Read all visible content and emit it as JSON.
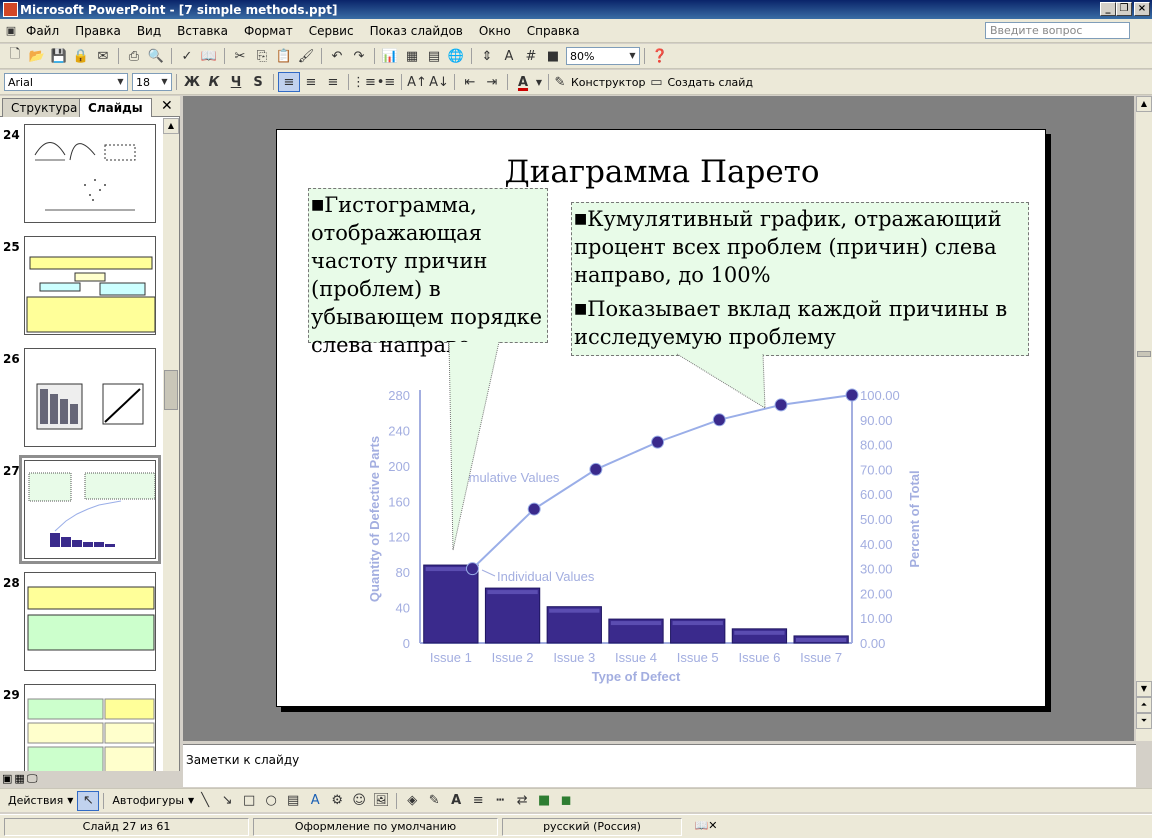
{
  "window": {
    "title": "Microsoft PowerPoint - [7 simple methods.ppt]"
  },
  "menu": [
    "Файл",
    "Правка",
    "Вид",
    "Вставка",
    "Формат",
    "Сервис",
    "Показ слайдов",
    "Окно",
    "Справка"
  ],
  "ask": {
    "placeholder": "Введите вопрос"
  },
  "toolbar": {
    "zoom": "80%"
  },
  "format": {
    "font": "Arial",
    "size": "18",
    "bold": "Ж",
    "italic": "К",
    "underline": "Ч",
    "shadow": "S",
    "designer": "Конструктор",
    "new_slide": "Создать слайд"
  },
  "panel": {
    "tab_outline": "Структура",
    "tab_slides": "Слайды"
  },
  "thumbnails": [
    {
      "num": "24"
    },
    {
      "num": "25"
    },
    {
      "num": "26"
    },
    {
      "num": "27"
    },
    {
      "num": "28"
    },
    {
      "num": "29"
    }
  ],
  "slide": {
    "title": "Диаграмма Парето",
    "callout_left": "Гистограмма, отображающая частоту причин (проблем) в убывающем порядке слева направо",
    "callout_right_1": "Кумулятивный график, отражающий процент всех проблем (причин) слева направо, до 100%",
    "callout_right_2": "Показывает вклад каждой причины в исследуемую проблему"
  },
  "chart_data": {
    "type": "bar",
    "categories": [
      "Issue 1",
      "Issue 2",
      "Issue 3",
      "Issue 4",
      "Issue 5",
      "Issue 6",
      "Issue 7"
    ],
    "series": [
      {
        "name": "Individual Values",
        "values": [
          88,
          62,
          41,
          27,
          27,
          16,
          8
        ]
      },
      {
        "name": "Cumulative Values",
        "values": [
          30,
          54,
          70,
          81,
          90,
          96,
          100
        ]
      }
    ],
    "xlabel": "Type of Defect",
    "ylabel": "Quantity of Defective Parts",
    "y2label": "Percent of Total",
    "ylim": [
      0,
      280
    ],
    "y2lim": [
      0,
      100
    ],
    "yticks": [
      "0",
      "40",
      "80",
      "120",
      "160",
      "200",
      "240",
      "280"
    ],
    "y2ticks": [
      "0.00",
      "10.00",
      "20.00",
      "30.00",
      "40.00",
      "50.00",
      "60.00",
      "70.00",
      "80.00",
      "90.00",
      "100.00"
    ],
    "colors": {
      "bar": "#3a2a8c",
      "line": "#9aaee8",
      "axis": "#a3aee0"
    }
  },
  "notes": {
    "placeholder": "Заметки к слайду"
  },
  "drawing": {
    "actions": "Действия",
    "autoshapes": "Автофигуры"
  },
  "status": {
    "slide": "Слайд 27 из 61",
    "design": "Оформление по умолчанию",
    "lang": "русский (Россия)"
  }
}
